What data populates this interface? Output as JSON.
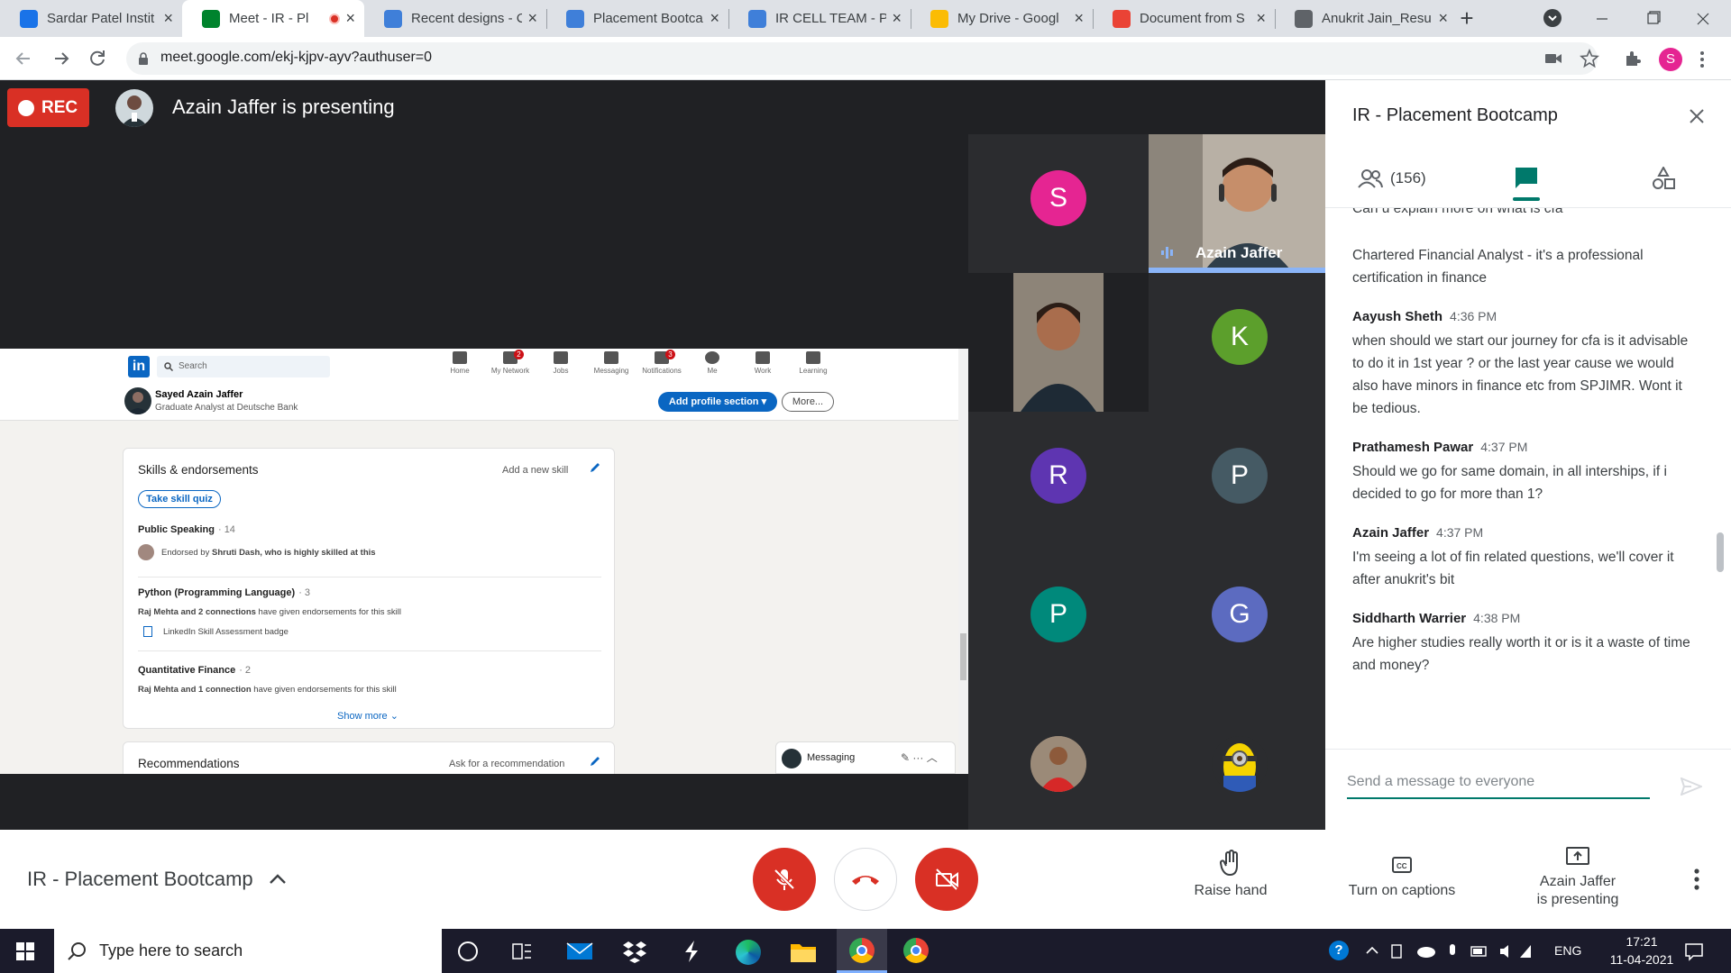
{
  "browser": {
    "tabs": [
      {
        "title": "Sardar Patel Instit",
        "favicon": "calendar-icon",
        "color": "#1a73e8"
      },
      {
        "title": "Meet - IR - Pl",
        "favicon": "meet-icon",
        "color": "#00832d",
        "active": true
      },
      {
        "title": "Recent designs - C",
        "favicon": "canva-icon",
        "color": "#3f7fd9"
      },
      {
        "title": "Placement Bootca",
        "favicon": "canva-icon",
        "color": "#3f7fd9"
      },
      {
        "title": "IR CELL TEAM - Pl",
        "favicon": "canva-icon",
        "color": "#3f7fd9"
      },
      {
        "title": "My Drive - Googl",
        "favicon": "drive-icon",
        "color": "#fbbc04"
      },
      {
        "title": "Document from S",
        "favicon": "gmail-icon",
        "color": "#ea4335"
      },
      {
        "title": "Anukrit Jain_Resu",
        "favicon": "globe-icon",
        "color": "#5f6368"
      }
    ],
    "url": "meet.google.com/ekj-kjpv-ayv?authuser=0",
    "profile_initial": "S"
  },
  "meet": {
    "rec_label": "REC",
    "presenting_text": "Azain Jaffer is presenting",
    "meeting_name": "IR - Placement Bootcamp",
    "speaker_name": "Azain Jaffer",
    "participants": [
      {
        "initial": "S",
        "color": "#e52592"
      },
      {
        "initial": "K",
        "color": "#5c9f2c"
      },
      {
        "initial": "R",
        "color": "#5e35b1"
      },
      {
        "initial": "P",
        "color": "#455a64"
      },
      {
        "initial": "P",
        "color": "#00897b"
      },
      {
        "initial": "G",
        "color": "#5c6bc0"
      }
    ],
    "controls": {
      "raise_hand": "Raise hand",
      "captions": "Turn on captions",
      "presenting_line1": "Azain Jaffer",
      "presenting_line2": "is presenting"
    }
  },
  "linkedin": {
    "search_placeholder": "Search",
    "nav": [
      "Home",
      "My Network",
      "Jobs",
      "Messaging",
      "Notifications",
      "Me",
      "Work",
      "Learning"
    ],
    "network_badge": "2",
    "notif_badge": "3",
    "profile_name": "Sayed Azain Jaffer",
    "profile_headline": "Graduate Analyst at Deutsche Bank",
    "add_profile_section": "Add profile section",
    "more_button": "More...",
    "skills_title": "Skills & endorsements",
    "add_skill": "Add a new skill",
    "take_quiz": "Take skill quiz",
    "skills": [
      {
        "name": "Public Speaking",
        "count": "· 14",
        "endorse_prefix": "Endorsed by ",
        "endorse_bold": "Shruti Dash, who is highly skilled at this",
        "endorse_suffix": ""
      },
      {
        "name": "Python (Programming Language)",
        "count": "· 3",
        "endorse_prefix": "",
        "endorse_bold": "Raj Mehta and 2 connections",
        "endorse_suffix": " have given endorsements for this skill",
        "badge": "LinkedIn Skill Assessment badge"
      },
      {
        "name": "Quantitative Finance",
        "count": "· 2",
        "endorse_prefix": "",
        "endorse_bold": "Raj Mehta and 1 connection",
        "endorse_suffix": " have given endorsements for this skill"
      }
    ],
    "show_more": "Show more",
    "recommendations_title": "Recommendations",
    "ask_recommendation": "Ask for a recommendation",
    "messaging_label": "Messaging"
  },
  "chat": {
    "title": "IR - Placement Bootcamp",
    "participant_count": "(156)",
    "partial_message": "Can u explain more on what is cfa",
    "messages": [
      {
        "sender": "",
        "time": "",
        "text": "Chartered Financial Analyst - it's a professional certification in finance"
      },
      {
        "sender": "Aayush Sheth",
        "time": "4:36 PM",
        "text": "when should we start our journey for cfa is it advisable to do it in 1st year ? or the last year cause we would also have minors in finance etc from SPJIMR. Wont it be tedious."
      },
      {
        "sender": "Prathamesh Pawar",
        "time": "4:37 PM",
        "text": "Should we go for same domain, in all interships, if i decided to go for more than 1?"
      },
      {
        "sender": "Azain Jaffer",
        "time": "4:37 PM",
        "text": "I'm seeing a lot of fin related questions, we'll cover it after anukrit's bit"
      },
      {
        "sender": "Siddharth Warrier",
        "time": "4:38 PM",
        "text": "Are higher studies really worth it or is it a waste of time and money?"
      }
    ],
    "input_placeholder": "Send a message to everyone"
  },
  "taskbar": {
    "search_placeholder": "Type here to search",
    "lang": "ENG",
    "time": "17:21",
    "date": "11-04-2021"
  }
}
